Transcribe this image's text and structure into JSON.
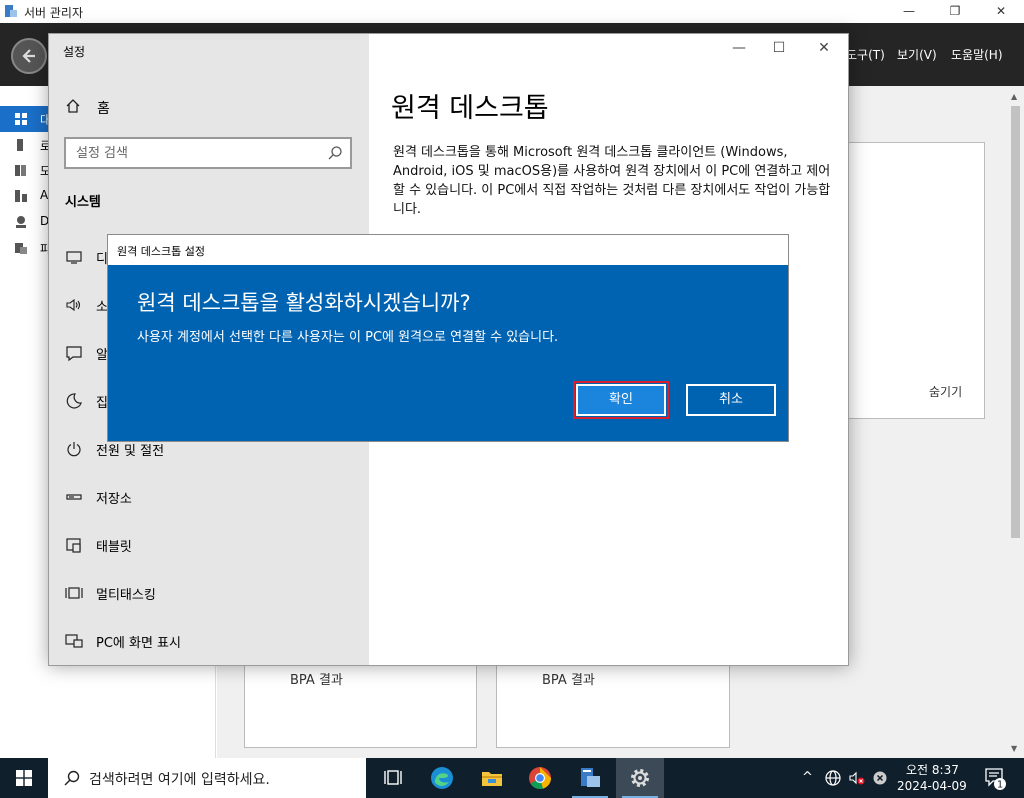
{
  "server_manager": {
    "title": "서버 관리자",
    "menus": [
      "도구(T)",
      "보기(V)",
      "도움말(H)"
    ],
    "nav_items": [
      "대",
      "로",
      "모",
      "A",
      "D",
      "파"
    ],
    "tiles": [
      {
        "bpa": "BPA 결과"
      },
      {
        "bpa": "BPA 결과"
      }
    ],
    "hide_label": "숨기기"
  },
  "settings": {
    "app_title": "설정",
    "home_label": "홈",
    "search_placeholder": "설정 검색",
    "section_title": "시스템",
    "nav": [
      {
        "label": "디",
        "icon": "display-icon"
      },
      {
        "label": "소",
        "icon": "sound-icon"
      },
      {
        "label": "알",
        "icon": "notifications-icon"
      },
      {
        "label": "집",
        "icon": "focus-assist-icon"
      },
      {
        "label": "전원 및 절전",
        "icon": "power-icon"
      },
      {
        "label": "저장소",
        "icon": "storage-icon"
      },
      {
        "label": "태블릿",
        "icon": "tablet-icon"
      },
      {
        "label": "멀티태스킹",
        "icon": "multitasking-icon"
      },
      {
        "label": "PC에 화면 표시",
        "icon": "projecting-icon"
      }
    ],
    "page_title": "원격 데스크톱",
    "description": "원격 데스크톱을 통해 Microsoft 원격 데스크톱 클라이언트 (Windows, Android, iOS 및 macOS용)를 사용하여 원격 장치에서 이 PC에 연결하고 제어할 수 있습니다. 이 PC에서 직접 작업하는 것처럼 다른 장치에서도 작업이 가능합니다."
  },
  "dialog": {
    "title": "원격 데스크톱 설정",
    "heading": "원격 데스크톱을 활성화하시겠습니까?",
    "message": "사용자 계정에서 선택한 다른 사용자는 이 PC에 원격으로 연결할 수 있습니다.",
    "ok_label": "확인",
    "cancel_label": "취소"
  },
  "taskbar": {
    "search_placeholder": "검색하려면 여기에 입력하세요.",
    "time": "오전 8:37",
    "date": "2024-04-09",
    "notification_count": "1"
  },
  "colors": {
    "dialog_bg": "#0063b1",
    "ok_button_bg": "#1b84dc",
    "highlight_border": "#d9202f",
    "taskbar_bg": "#0f1f2b"
  }
}
